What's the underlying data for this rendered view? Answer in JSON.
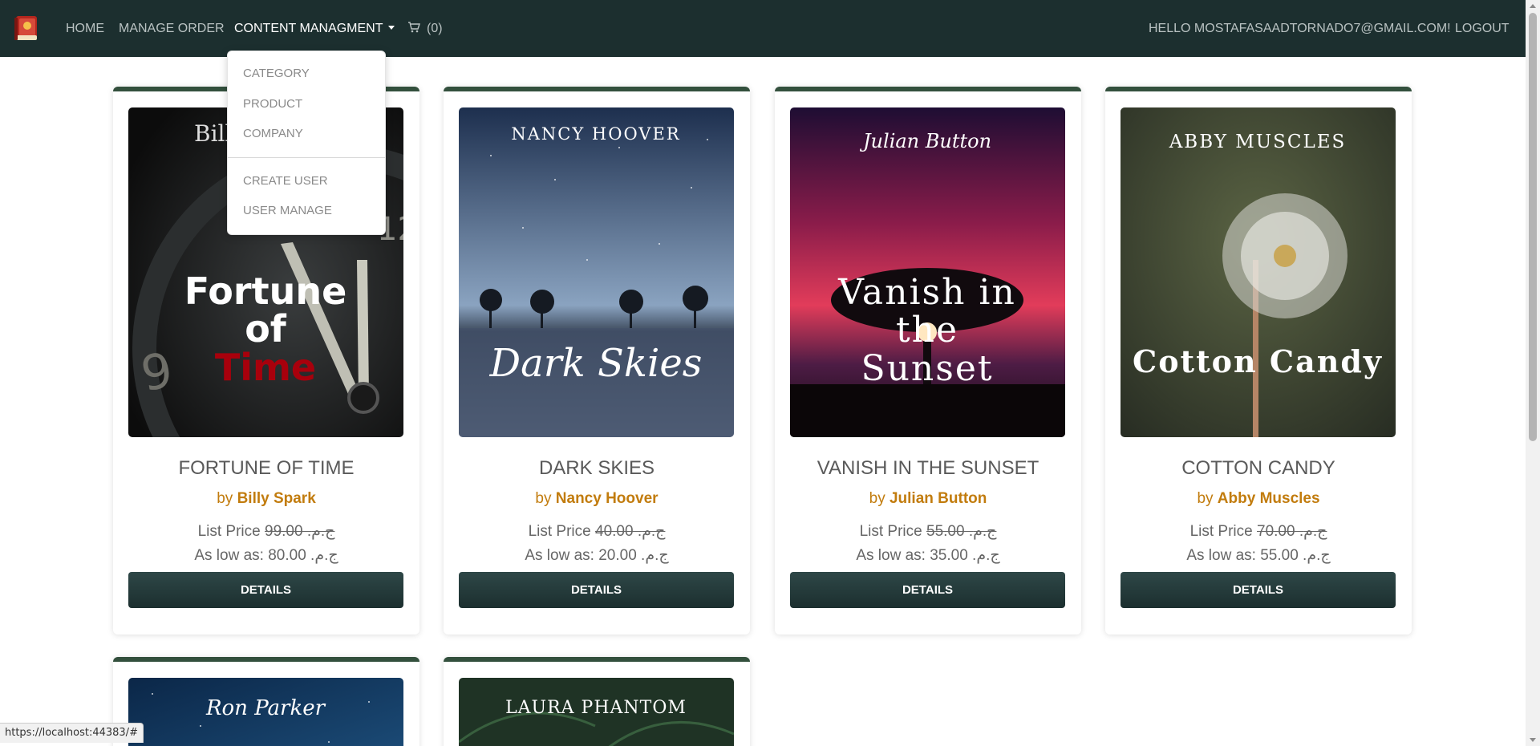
{
  "nav": {
    "home": "HOME",
    "manage_order": "MANAGE ORDER",
    "content_management": "CONTENT MANAGMENT",
    "cart_count": "(0)",
    "greeting": "HELLO MOSTAFASAADTORNADO7@GMAIL.COM!",
    "logout": "LOGOUT"
  },
  "dropdown": {
    "category": "CATEGORY",
    "product": "PRODUCT",
    "company": "COMPANY",
    "create_user": "CREATE USER",
    "user_manage": "USER MANAGE"
  },
  "labels": {
    "by": "by",
    "list_price": "List Price",
    "as_low_as": "As low as:",
    "details": "DETAILS"
  },
  "books": [
    {
      "title": "FORTUNE OF TIME",
      "author": "Billy Spark",
      "list_price": "99.00 .ج.م",
      "low_price": "80.00 .ج.م",
      "cover_author": "Billy Spark",
      "cover_title_1": "Fortune",
      "cover_title_2": "of",
      "cover_title_3": "Time"
    },
    {
      "title": "DARK SKIES",
      "author": "Nancy Hoover",
      "list_price": "40.00 .ج.م",
      "low_price": "20.00 .ج.م",
      "cover_author": "NANCY HOOVER",
      "cover_title_1": "Dark Skies"
    },
    {
      "title": "VANISH IN THE SUNSET",
      "author": "Julian Button",
      "list_price": "55.00 .ج.م",
      "low_price": "35.00 .ج.م",
      "cover_author": "Julian Button",
      "cover_title_1": "Vanish in",
      "cover_title_2": "the",
      "cover_title_3": "Sunset"
    },
    {
      "title": "COTTON CANDY",
      "author": "Abby Muscles",
      "list_price": "70.00 .ج.م",
      "low_price": "55.00 .ج.م",
      "cover_author": "ABBY MUSCLES",
      "cover_title_1": "Cotton Candy"
    },
    {
      "cover_author": "Ron Parker"
    },
    {
      "cover_author": "LAURA PHANTOM"
    }
  ],
  "status_url": "https://localhost:44383/#"
}
